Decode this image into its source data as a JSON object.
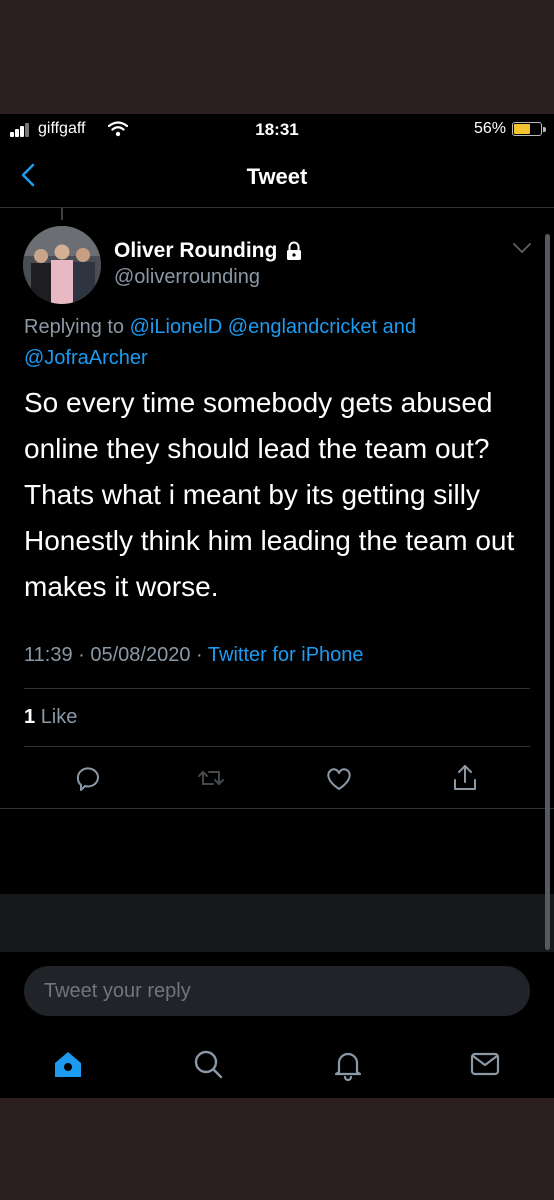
{
  "status_bar": {
    "carrier": "giffgaff",
    "time": "18:31",
    "battery_percent": "56%",
    "battery_level": 0.56
  },
  "nav": {
    "title": "Tweet",
    "back_icon": "chevron-left-icon"
  },
  "tweet": {
    "author_name": "Oliver Rounding",
    "author_handle": "@oliverrounding",
    "protected_icon": "lock-icon",
    "replying_prefix": "Replying to",
    "replying_mentions": [
      "@iLionelD",
      "@englandcricket",
      "@JofraArcher"
    ],
    "replying_and": "and",
    "text": "So every time somebody gets abused online they should lead the team out? Thats what i meant by its getting silly Honestly think him leading the team out makes it worse.",
    "time": "11:39",
    "date": "05/08/2020",
    "separator": "·",
    "source": "Twitter for iPhone",
    "like_count": "1",
    "like_label": "Like"
  },
  "actions": [
    "reply-icon",
    "retweet-icon",
    "like-icon",
    "share-icon"
  ],
  "reply": {
    "placeholder": "Tweet your reply"
  },
  "tabbar": [
    "home-icon",
    "search-icon",
    "notifications-icon",
    "messages-icon"
  ],
  "colors": {
    "background": "#000000",
    "accent": "#1d9bf0",
    "secondary_text": "#8b98a5",
    "battery": "#f4c430"
  }
}
